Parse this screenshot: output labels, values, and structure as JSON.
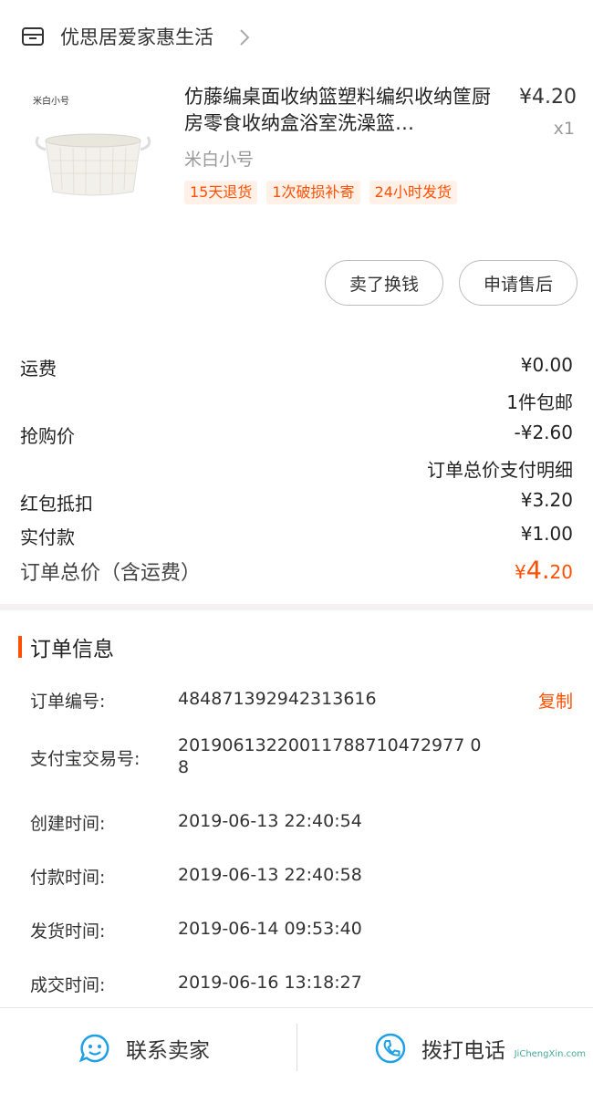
{
  "shop": {
    "name": "优思居爱家惠生活",
    "icon": "store-icon"
  },
  "product": {
    "thumb_label": "米白小号",
    "title": "仿藤编桌面收纳篮塑料编织收纳筐厨房零食收纳盒浴室洗澡篮…",
    "price": "¥4.20",
    "qty": "x1",
    "sku": "米白小号",
    "tags": [
      "15天退货",
      "1次破损补寄",
      "24小时发货"
    ]
  },
  "actions": {
    "sell": "卖了换钱",
    "after_sale": "申请售后"
  },
  "costs": {
    "shipping_label": "运费",
    "shipping_value": "¥0.00",
    "shipping_note": "1件包邮",
    "flash_label": "抢购价",
    "flash_value": "-¥2.60",
    "detail_link": "订单总价支付明细",
    "redpack_label": "红包抵扣",
    "redpack_value": "¥3.20",
    "paid_label": "实付款",
    "paid_value": "¥1.00",
    "total_label": "订单总价（含运费）",
    "total_symbol": "¥",
    "total_int": "4.",
    "total_dec": "20"
  },
  "order_info": {
    "title": "订单信息",
    "copy_label": "复制",
    "rows": [
      {
        "k": "订单编号:",
        "v": "484871392942313616"
      },
      {
        "k": "支付宝交易号:",
        "v": "20190613220011788710472977 08"
      },
      {
        "k": "创建时间:",
        "v": "2019-06-13 22:40:54"
      },
      {
        "k": "付款时间:",
        "v": "2019-06-13 22:40:58"
      },
      {
        "k": "发货时间:",
        "v": "2019-06-14 09:53:40"
      },
      {
        "k": "成交时间:",
        "v": "2019-06-16 13:18:27"
      }
    ]
  },
  "bottom": {
    "contact": "联系卖家",
    "call": "拨打电话"
  },
  "watermark": "JiChengXin.com",
  "colors": {
    "accent": "#ff5000",
    "icon_blue": "#1ea0e6"
  }
}
